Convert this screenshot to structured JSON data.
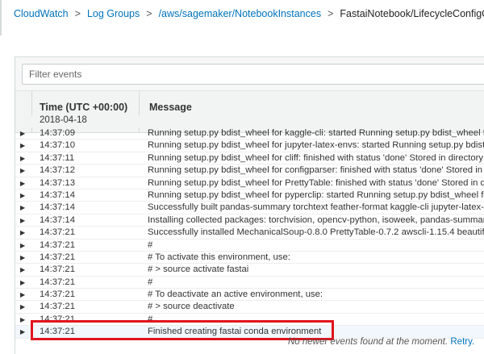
{
  "breadcrumb": {
    "items": [
      "CloudWatch",
      "Log Groups",
      "/aws/sagemaker/NotebookInstances"
    ],
    "separator": ">",
    "current": "FastaiNotebook/LifecycleConfigOnStart"
  },
  "filter": {
    "placeholder": "Filter events",
    "value": ""
  },
  "table": {
    "headers": {
      "time": "Time (UTC +00:00)",
      "message": "Message"
    },
    "date": "2018-04-18",
    "rows": [
      {
        "time": "14:37:09",
        "message": "Running setup.py bdist_wheel for kaggle-cli: started Running setup.py bdist_wheel for k"
      },
      {
        "time": "14:37:10",
        "message": "Running setup.py bdist_wheel for jupyter-latex-envs: started Running setup.py bdist_w"
      },
      {
        "time": "14:37:11",
        "message": "Running setup.py bdist_wheel for cliff: finished with status 'done' Stored in directory: /h"
      },
      {
        "time": "14:37:12",
        "message": "Running setup.py bdist_wheel for configparser: finished with status 'done' Stored in dire"
      },
      {
        "time": "14:37:13",
        "message": "Running setup.py bdist_wheel for PrettyTable: finished with status 'done' Stored in direc"
      },
      {
        "time": "14:37:14",
        "message": "Running setup.py bdist_wheel for pyperclip: started Running setup.py bdist_wheel for p"
      },
      {
        "time": "14:37:14",
        "message": "Successfully built pandas-summary torchtext feather-format kaggle-cli jupyter-latex-env"
      },
      {
        "time": "14:37:14",
        "message": "Installing collected packages: torchvision, opencv-python, isoweek, pandas-summary, t"
      },
      {
        "time": "14:37:21",
        "message": "Successfully installed MechanicalSoup-0.8.0 PrettyTable-0.7.2 awscli-1.15.4 beautifulsc"
      },
      {
        "time": "14:37:21",
        "message": "#"
      },
      {
        "time": "14:37:21",
        "message": "# To activate this environment, use:"
      },
      {
        "time": "14:37:21",
        "message": "# > source activate fastai"
      },
      {
        "time": "14:37:21",
        "message": "#"
      },
      {
        "time": "14:37:21",
        "message": "# To deactivate an active environment, use:"
      },
      {
        "time": "14:37:21",
        "message": "# > source deactivate"
      },
      {
        "time": "14:37:21",
        "message": "#"
      },
      {
        "time": "14:37:21",
        "message": "Finished creating fastai conda environment"
      }
    ]
  },
  "status": {
    "text": "No newer events found at the moment.",
    "retry": "Retry."
  },
  "colors": {
    "link": "#0073bb",
    "highlight_border": "#e0141e"
  }
}
